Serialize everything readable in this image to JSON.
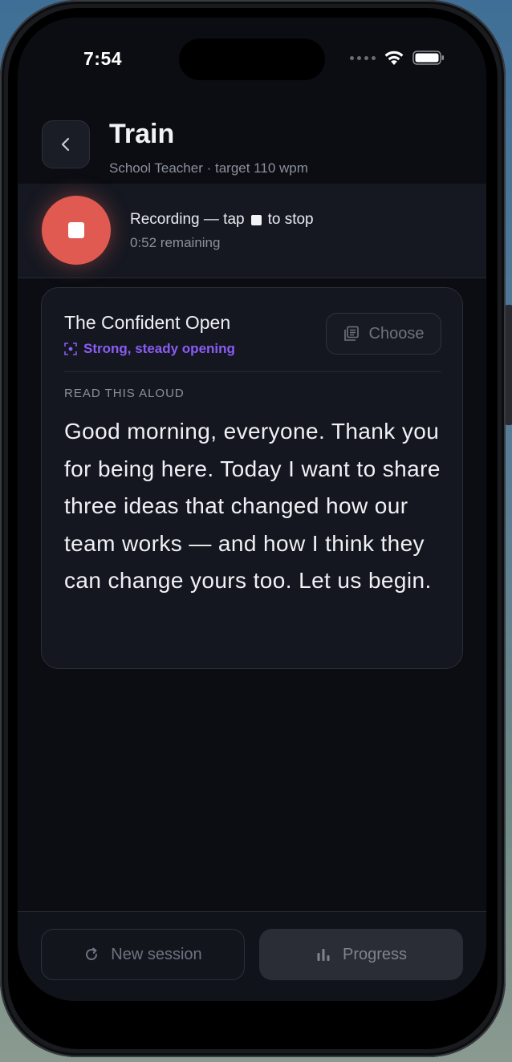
{
  "status_bar": {
    "time": "7:54"
  },
  "header": {
    "title": "Train",
    "subtitle": "School Teacher · target 110 wpm"
  },
  "recording": {
    "label_before": "Recording — tap",
    "label_after": "to stop",
    "remaining": "0:52 remaining",
    "color": "#e05a52"
  },
  "script_card": {
    "title": "The Confident Open",
    "tag": "Strong, steady opening",
    "tag_color": "#8b5cf6",
    "choose_label": "Choose",
    "section_label": "READ THIS ALOUD",
    "script": "Good morning, everyone. Thank you for being here. Today I want to share three ideas that changed how our team works — and how I think they can change yours too. Let us begin."
  },
  "actions": {
    "new_session_label": "New session",
    "progress_label": "Progress"
  },
  "icons": {
    "back": "chevron-left-icon",
    "stop": "stop-icon",
    "tag": "focus-icon",
    "choose": "library-icon",
    "new_session": "refresh-icon",
    "progress": "bar-chart-icon"
  }
}
